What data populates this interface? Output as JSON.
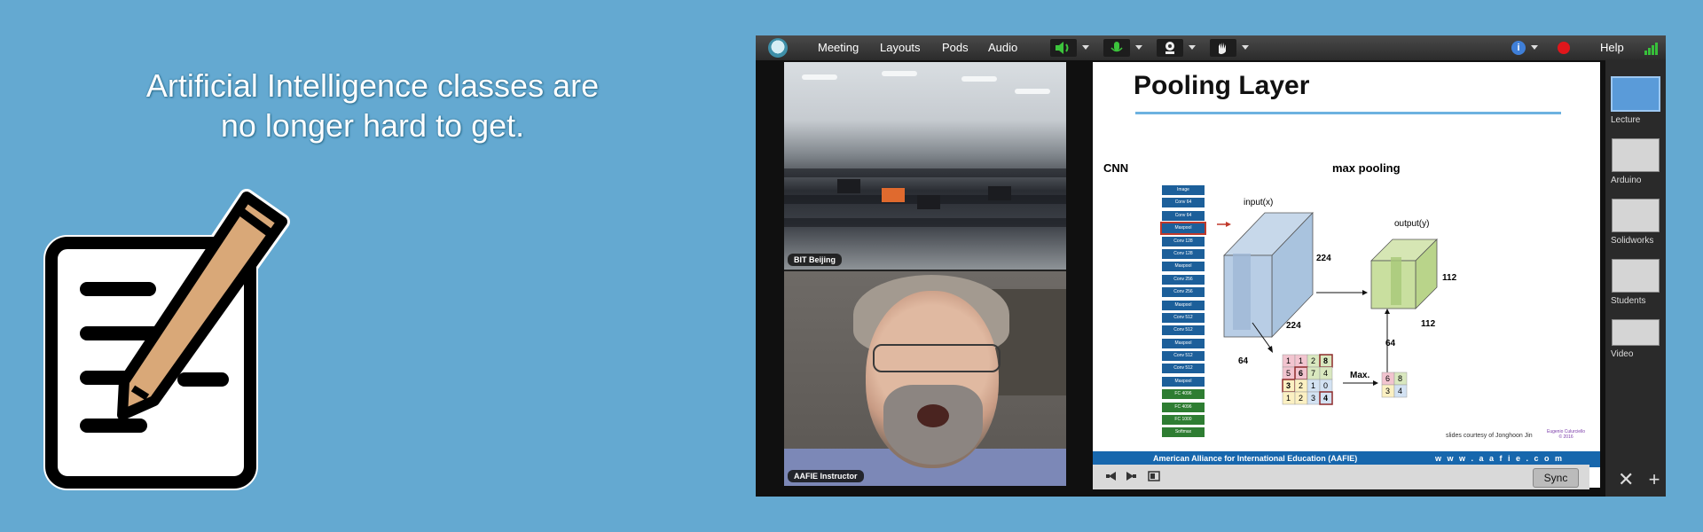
{
  "headline": {
    "line1": "Artificial Intelligence classes are",
    "line2": "no longer hard to get."
  },
  "menubar": {
    "items": [
      "Meeting",
      "Layouts",
      "Pods",
      "Audio"
    ],
    "help": "Help"
  },
  "videos": [
    {
      "label": "BIT Beijing"
    },
    {
      "label": "AAFIE Instructor"
    }
  ],
  "slide": {
    "title": "Pooling Layer",
    "cnn_label": "CNN",
    "max_pooling_label": "max pooling",
    "layers": [
      "Image",
      "Conv 64",
      "Conv 64",
      "Maxpool",
      "Conv 128",
      "Conv 128",
      "Maxpool",
      "Conv 256",
      "Conv 256",
      "Maxpool",
      "Conv 512",
      "Conv 512",
      "Maxpool",
      "Conv 512",
      "Conv 512",
      "Maxpool",
      "FC 4096",
      "FC 4096",
      "FC 1000",
      "Softmax"
    ],
    "input_label": "input(x)",
    "output_label": "output(y)",
    "input_dims": {
      "height": "224",
      "width": "224",
      "depth": "64"
    },
    "output_dims": {
      "height": "112",
      "width": "112",
      "depth": "64"
    },
    "grid_values": [
      [
        "1",
        "1",
        "2",
        "8"
      ],
      [
        "5",
        "6",
        "7",
        "4"
      ],
      [
        "3",
        "2",
        "1",
        "0"
      ],
      [
        "1",
        "2",
        "3",
        "4"
      ]
    ],
    "pooled_values": [
      [
        "6",
        "8"
      ],
      [
        "3",
        "4"
      ]
    ],
    "max_label": "Max.",
    "credit": "slides courtesy of Jonghoon Jin",
    "credit2_line1": "Eugenio Culurciello",
    "credit2_line2": "© 2016",
    "footer_left": "American Alliance for International Education (AAFIE)",
    "footer_right": "w w w . a a f i e . c o m"
  },
  "controls": {
    "sync_label": "Sync"
  },
  "layouts": [
    "Lecture",
    "Arduino",
    "Solidworks",
    "Students",
    "Video"
  ]
}
